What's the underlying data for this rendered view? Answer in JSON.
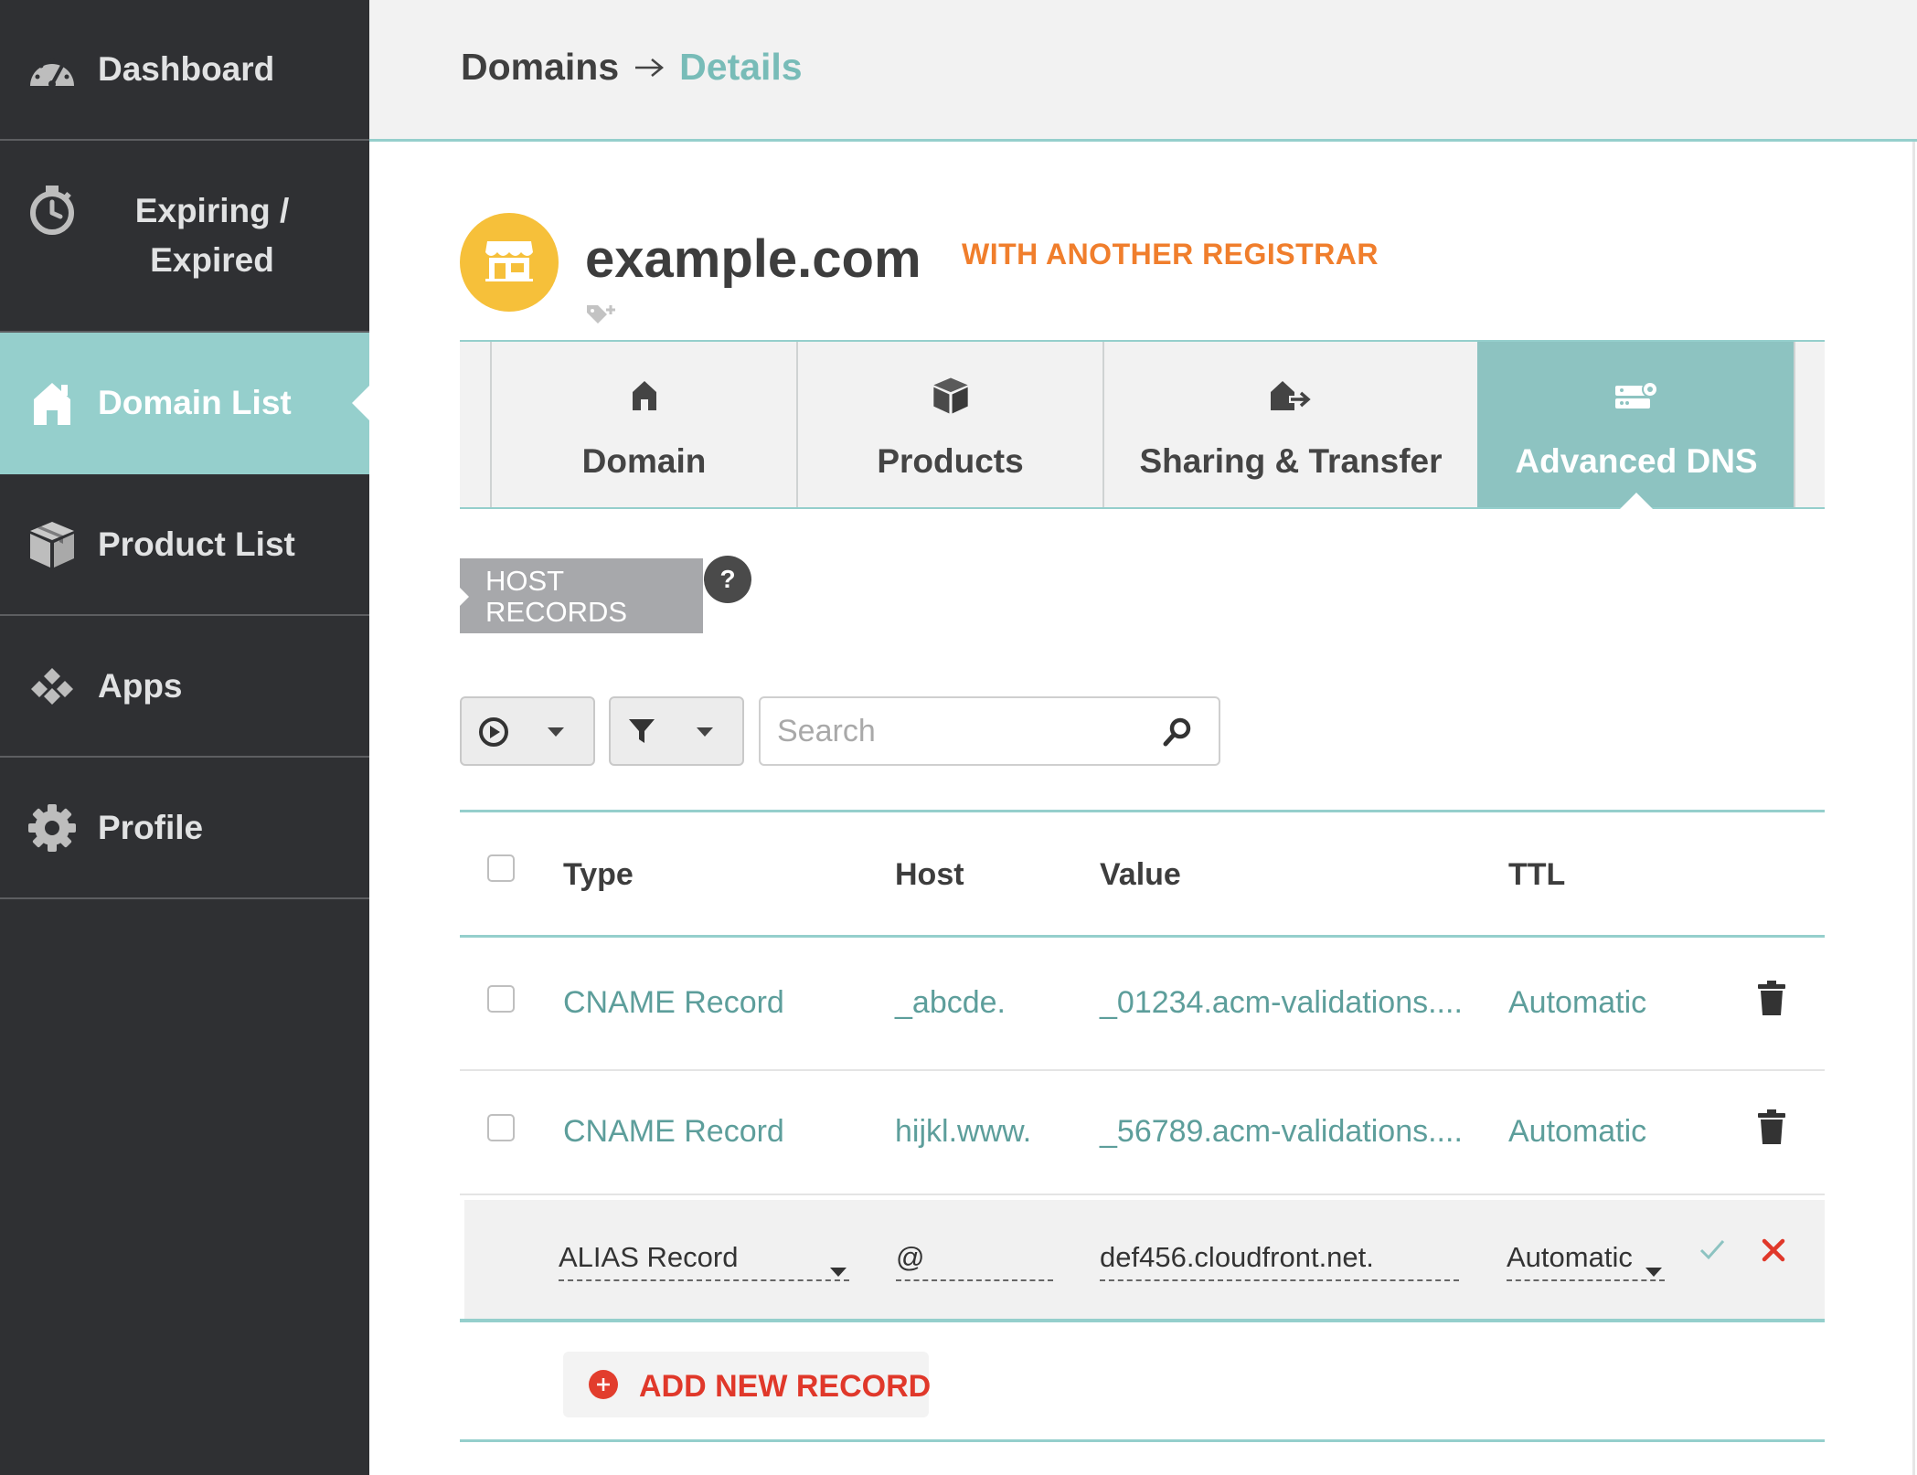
{
  "sidebar": {
    "items": [
      {
        "label": "Dashboard",
        "icon": "speedometer-icon"
      },
      {
        "label": "Expiring /",
        "label2": "Expired",
        "icon": "timer-icon"
      },
      {
        "label": "Domain List",
        "icon": "home-icon",
        "active": true
      },
      {
        "label": "Product List",
        "icon": "box-icon"
      },
      {
        "label": "Apps",
        "icon": "apps-icon"
      },
      {
        "label": "Profile",
        "icon": "gear-icon"
      }
    ]
  },
  "header": {
    "breadcrumb_root": "Domains",
    "breadcrumb_current": "Details"
  },
  "domain": {
    "name": "example.com",
    "status": "WITH ANOTHER REGISTRAR",
    "badge_icon": "storefront-icon"
  },
  "tabs": [
    {
      "label": "Domain",
      "icon": "home-icon"
    },
    {
      "label": "Products",
      "icon": "box-icon"
    },
    {
      "label": "Sharing & Transfer",
      "icon": "house-transfer-icon"
    },
    {
      "label": "Advanced DNS",
      "icon": "server-gear-icon",
      "active": true
    }
  ],
  "section": {
    "title_line1": "HOST",
    "title_line2": "RECORDS",
    "help": "?"
  },
  "toolbar": {
    "search_placeholder": "Search"
  },
  "table": {
    "columns": [
      "Type",
      "Host",
      "Value",
      "TTL"
    ],
    "rows": [
      {
        "type": "CNAME Record",
        "host": "_abcde.",
        "value": "_01234.acm-validations....",
        "ttl": "Automatic"
      },
      {
        "type": "CNAME Record",
        "host": "hijkl.www.",
        "value": "_56789.acm-validations....",
        "ttl": "Automatic"
      }
    ],
    "edit_row": {
      "type": "ALIAS Record",
      "host": "@",
      "value": "def456.cloudfront.net.",
      "ttl": "Automatic"
    }
  },
  "add_record_label": "ADD NEW RECORD",
  "colors": {
    "sidebar_bg": "#2f3033",
    "accent_teal": "#95cfcc",
    "link_teal": "#5d9e9b",
    "registrar_orange": "#f07e2c",
    "badge_yellow": "#f6c03a",
    "danger_red": "#e0382a"
  }
}
